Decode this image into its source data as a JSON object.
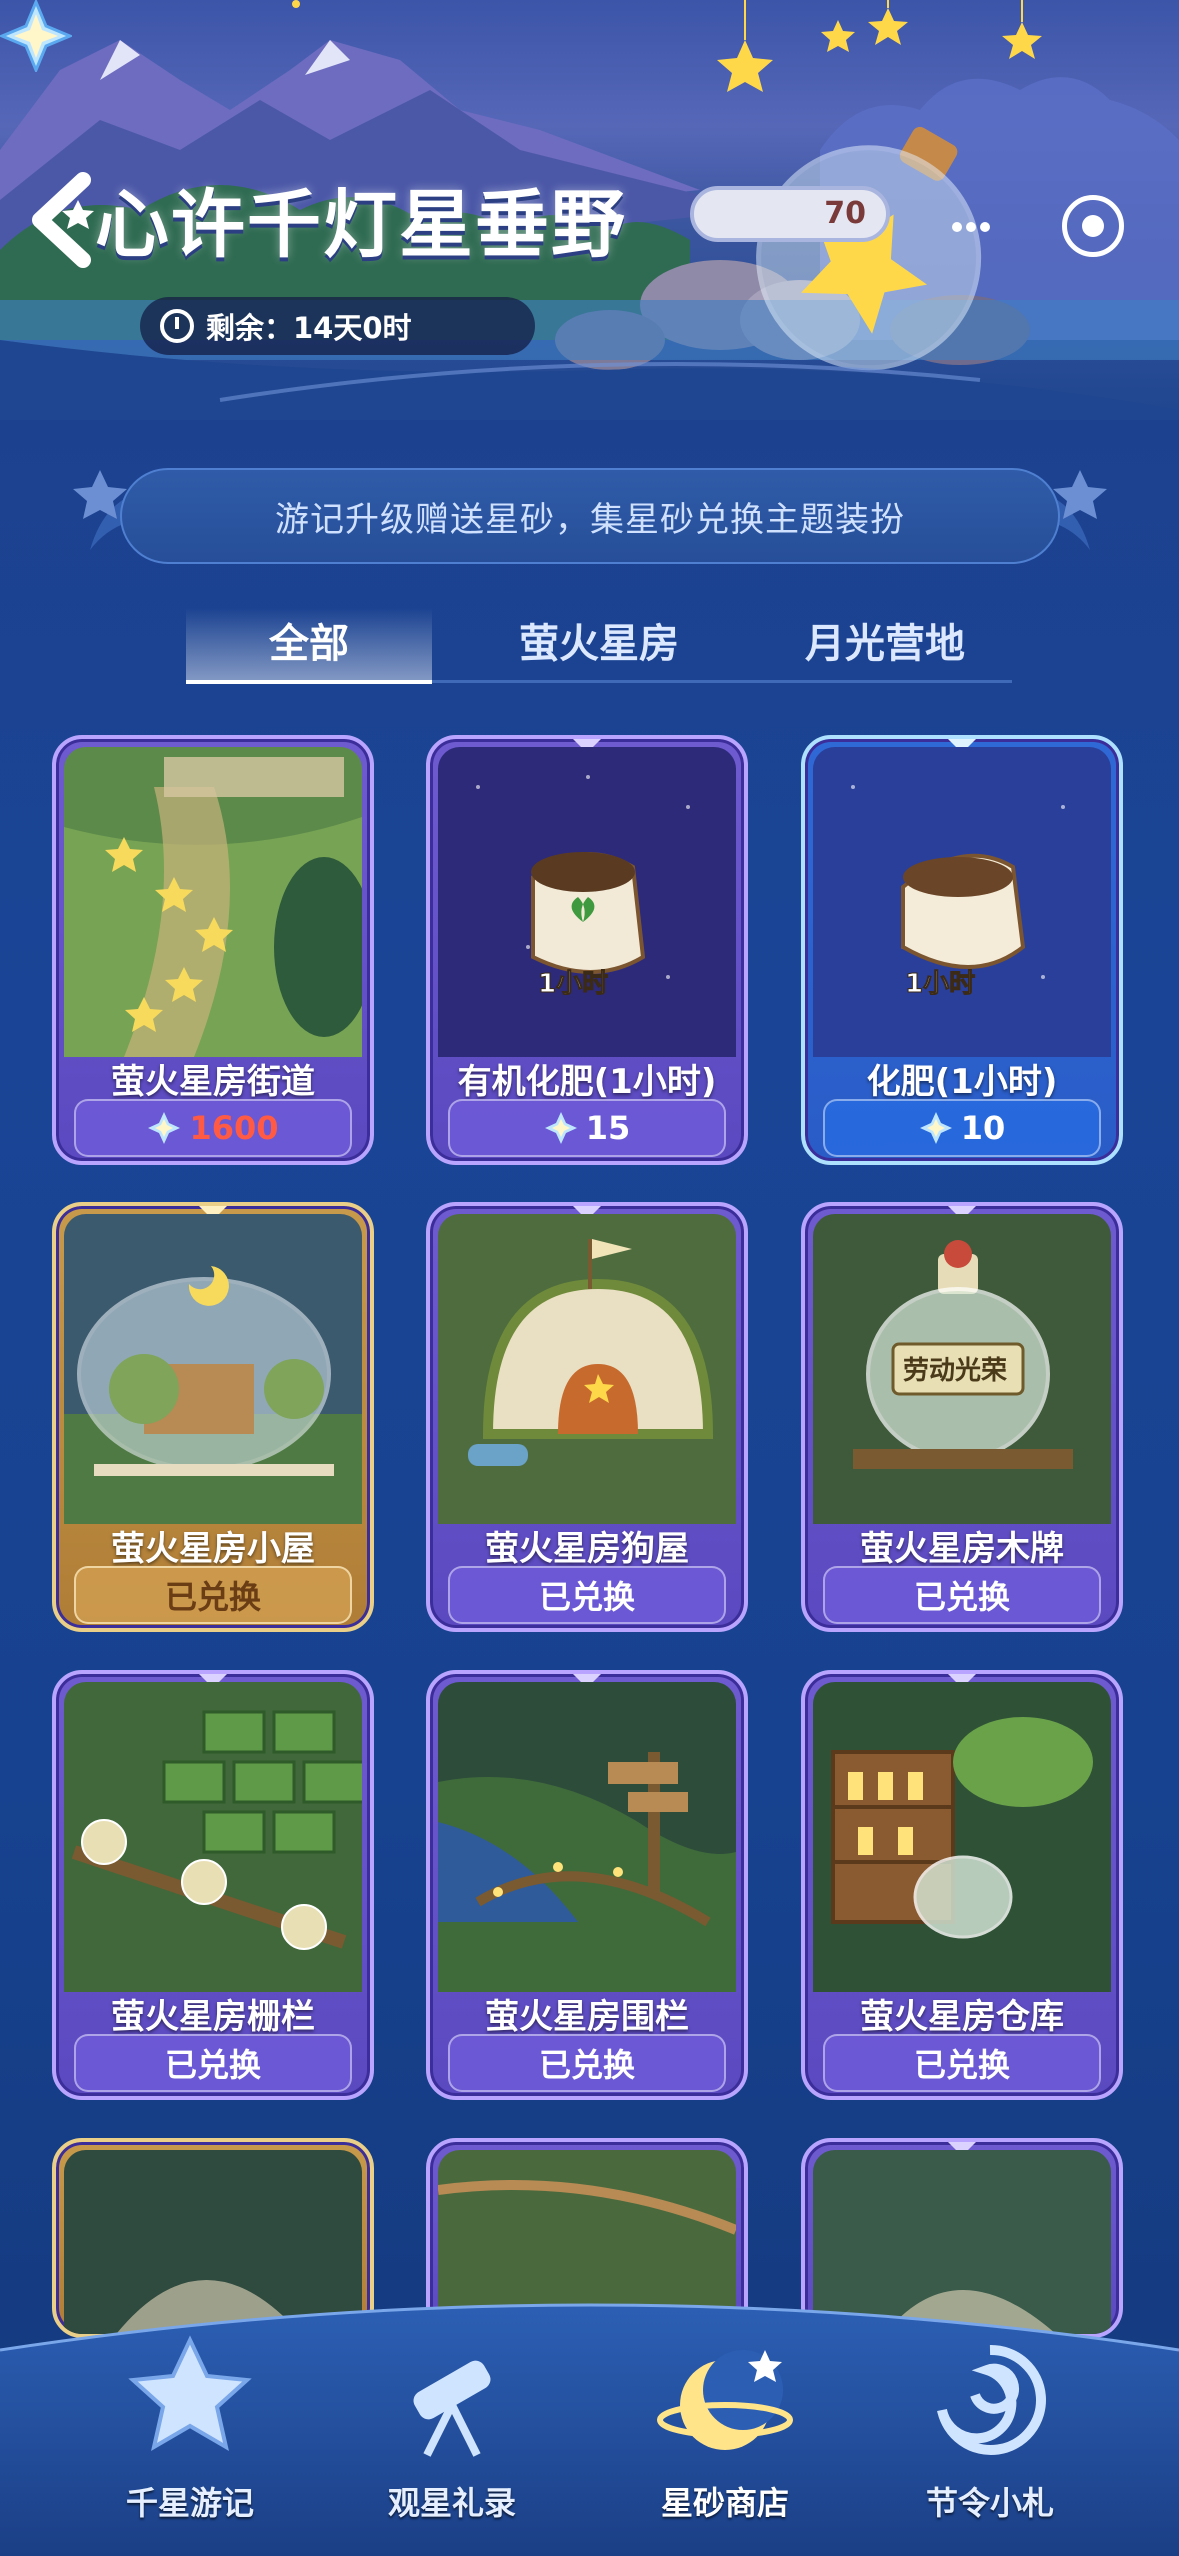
{
  "header": {
    "title": "心许千灯星垂野",
    "timer_label": "剩余：14天0时",
    "currency_value": "70"
  },
  "banner": {
    "text": "游记升级赠送星砂，集星砂兑换主题装扮"
  },
  "tabs": [
    {
      "label": "全部",
      "active": true
    },
    {
      "label": "萤火星房",
      "active": false
    },
    {
      "label": "月光营地",
      "active": false
    }
  ],
  "items": [
    {
      "name": "萤火星房街道",
      "price": "1600",
      "status": "",
      "style": "purple"
    },
    {
      "name": "有机化肥(1小时)",
      "price": "15",
      "status": "",
      "style": "purple",
      "badge": "1小时"
    },
    {
      "name": "化肥(1小时)",
      "price": "10",
      "status": "",
      "style": "blue",
      "badge": "1小时"
    },
    {
      "name": "萤火星房小屋",
      "price": "",
      "status": "已兑换",
      "style": "gold"
    },
    {
      "name": "萤火星房狗屋",
      "price": "",
      "status": "已兑换",
      "style": "purple"
    },
    {
      "name": "萤火星房木牌",
      "price": "",
      "status": "已兑换",
      "style": "purple",
      "sign": "劳动光荣"
    },
    {
      "name": "萤火星房栅栏",
      "price": "",
      "status": "已兑换",
      "style": "purple"
    },
    {
      "name": "萤火星房围栏",
      "price": "",
      "status": "已兑换",
      "style": "purple"
    },
    {
      "name": "萤火星房仓库",
      "price": "",
      "status": "已兑换",
      "style": "purple"
    }
  ],
  "bottom_nav": [
    {
      "label": "千星游记",
      "icon": "star-icon"
    },
    {
      "label": "观星礼录",
      "icon": "telescope-icon"
    },
    {
      "label": "星砂商店",
      "icon": "moon-planet-icon",
      "active": true
    },
    {
      "label": "节令小札",
      "icon": "swirl-icon"
    }
  ],
  "colors": {
    "background": "#1a4596",
    "card_purple": "#5a49c0",
    "card_gold": "#b07d36",
    "card_blue": "#2a5cc7",
    "price_red": "#ff5a43"
  }
}
